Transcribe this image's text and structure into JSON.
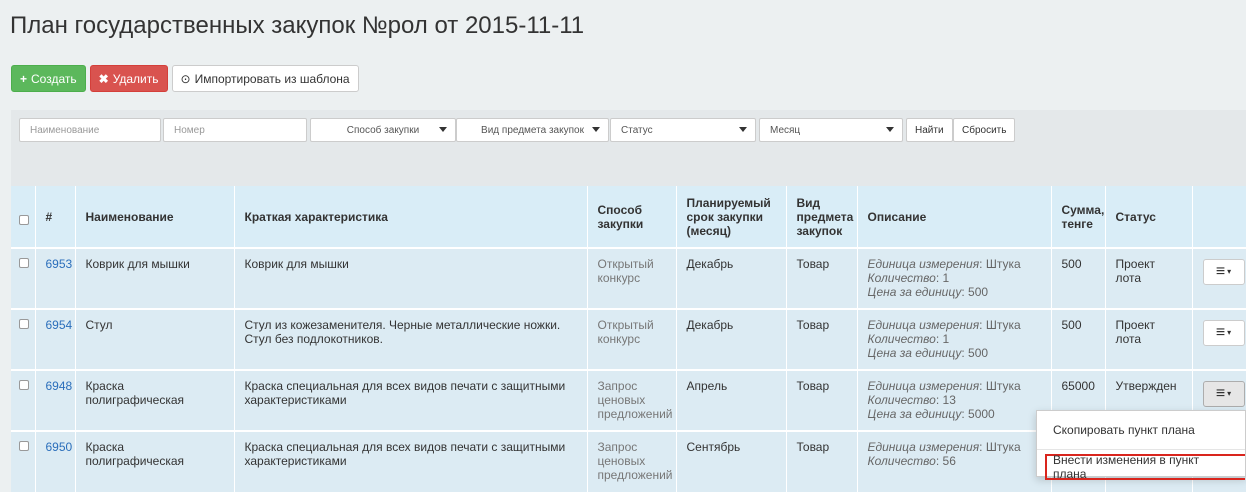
{
  "page": {
    "title": "План государственных закупок №рол от 2015-11-11"
  },
  "toolbar": {
    "create_label": "Создать",
    "delete_label": "Удалить",
    "import_label": "Импортировать из шаблона"
  },
  "filters": {
    "name_placeholder": "Наименование",
    "number_placeholder": "Номер",
    "method_label": "Способ закупки",
    "subject_label": "Вид предмета закупок",
    "status_label": "Статус",
    "month_label": "Месяц",
    "find_label": "Найти",
    "reset_label": "Сбросить"
  },
  "table": {
    "headers": {
      "num": "#",
      "name": "Наименование",
      "short": "Краткая характеристика",
      "method": "Способ закупки",
      "month": "Планируемый срок закупки (месяц)",
      "subject": "Вид предмета закупок",
      "desc": "Описание",
      "sum": "Сумма, тенге",
      "status": "Статус"
    },
    "desc_labels": {
      "unit": "Единица измерения",
      "qty": "Количество",
      "price": "Цена за единицу"
    },
    "rows": [
      {
        "id": "6953",
        "name": "Коврик для мышки",
        "short": "Коврик для мышки",
        "method": "Открытый конкурс",
        "month": "Декабрь",
        "subject": "Товар",
        "unit": "Штука",
        "qty": "1",
        "price": "500",
        "sum": "500",
        "status": "Проект лота"
      },
      {
        "id": "6954",
        "name": "Стул",
        "short": "Стул из кожезаменителя. Черные металлические ножки. Стул без подлокотников.",
        "method": "Открытый конкурс",
        "month": "Декабрь",
        "subject": "Товар",
        "unit": "Штука",
        "qty": "1",
        "price": "500",
        "sum": "500",
        "status": "Проект лота"
      },
      {
        "id": "6948",
        "name": "Краска полиграфическая",
        "short": "Краска специальная для всех видов печати с защитными характеристиками",
        "method": "Запрос ценовых предложений",
        "month": "Апрель",
        "subject": "Товар",
        "unit": "Штука",
        "qty": "13",
        "price": "5000",
        "sum": "65000",
        "status": "Утвержден"
      },
      {
        "id": "6950",
        "name": "Краска полиграфическая",
        "short": "Краска специальная для всех видов печати с защитными характеристиками",
        "method": "Запрос ценовых предложений",
        "month": "Сентябрь",
        "subject": "Товар",
        "unit": "Штука",
        "qty": "56",
        "price": "",
        "sum": "",
        "status": ""
      }
    ]
  },
  "dropdown": {
    "copy_label": "Скопировать пункт плана",
    "edit_label": "Внести изменения в пункт плана"
  },
  "colors": {
    "accent_green": "#5cb85c",
    "accent_red": "#d9534f",
    "link": "#2a6ebb",
    "header_bg": "#d9edf7"
  }
}
